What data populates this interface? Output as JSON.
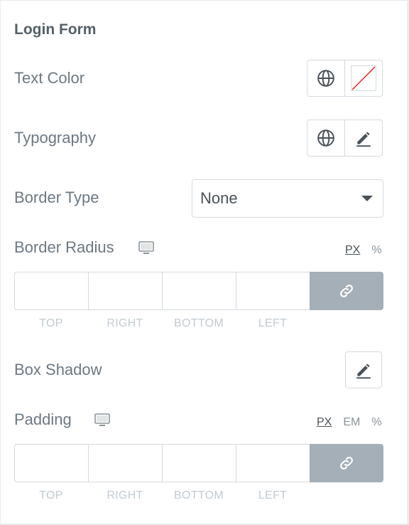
{
  "panel": {
    "section_title": "Login Form",
    "text_color": {
      "label": "Text Color",
      "global_icon": "globe-icon",
      "swatch": "none",
      "swatch_slash_color": "#e2231a"
    },
    "typography": {
      "label": "Typography",
      "global_icon": "globe-icon",
      "edit_icon": "pencil-icon"
    },
    "border_type": {
      "label": "Border Type",
      "value": "None"
    },
    "border_radius": {
      "label": "Border Radius",
      "device_icon": "desktop-icon",
      "units": [
        "PX",
        "%"
      ],
      "active_unit": "PX",
      "fields": [
        "TOP",
        "RIGHT",
        "BOTTOM",
        "LEFT"
      ],
      "link_icon": "link-icon"
    },
    "box_shadow": {
      "label": "Box Shadow",
      "edit_icon": "pencil-icon"
    },
    "padding": {
      "label": "Padding",
      "device_icon": "desktop-icon",
      "units": [
        "PX",
        "EM",
        "%"
      ],
      "active_unit": "PX",
      "fields": [
        "TOP",
        "RIGHT",
        "BOTTOM",
        "LEFT"
      ],
      "link_icon": "link-icon"
    }
  },
  "colors": {
    "link_button_bg": "#a4afb7",
    "label_text": "#6d7882",
    "border": "#d5dadf"
  }
}
